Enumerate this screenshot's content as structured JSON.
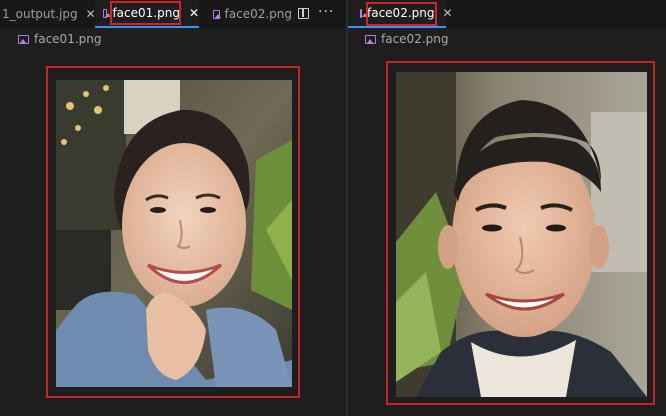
{
  "left_pane": {
    "tabs": [
      {
        "label": "1_output.jpg",
        "icon": "image-file-icon",
        "close": "✕",
        "active": false
      },
      {
        "label": "face01.png",
        "icon": "image-file-icon",
        "close": "✕",
        "active": true
      },
      {
        "label": "face02.png",
        "icon": "image-file-icon",
        "active": false
      }
    ],
    "actions": {
      "split": "split-editor-icon",
      "more": "···"
    },
    "breadcrumb": "face01.png"
  },
  "right_pane": {
    "tabs": [
      {
        "label": "face02.png",
        "icon": "image-file-icon",
        "close": "✕",
        "active": true
      }
    ],
    "breadcrumb": "face02.png"
  },
  "colors": {
    "editor_bg": "#1e1e1e",
    "tab_bar_bg": "#181818",
    "annotation_red": "#d1232a",
    "image_icon": "#b180d7",
    "active_tab_border": "#3794ff"
  }
}
